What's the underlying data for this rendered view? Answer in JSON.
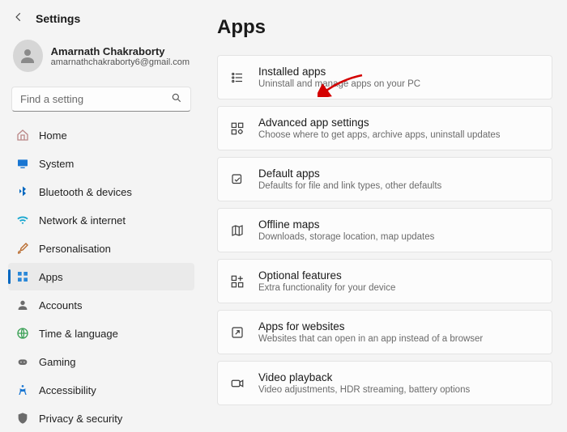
{
  "header": {
    "title": "Settings"
  },
  "user": {
    "name": "Amarnath Chakraborty",
    "email": "amarnathchakraborty6@gmail.com"
  },
  "search": {
    "placeholder": "Find a setting"
  },
  "sidebar": {
    "items": [
      {
        "label": "Home"
      },
      {
        "label": "System"
      },
      {
        "label": "Bluetooth & devices"
      },
      {
        "label": "Network & internet"
      },
      {
        "label": "Personalisation"
      },
      {
        "label": "Apps"
      },
      {
        "label": "Accounts"
      },
      {
        "label": "Time & language"
      },
      {
        "label": "Gaming"
      },
      {
        "label": "Accessibility"
      },
      {
        "label": "Privacy & security"
      }
    ]
  },
  "page": {
    "title": "Apps"
  },
  "cards": [
    {
      "title": "Installed apps",
      "sub": "Uninstall and manage apps on your PC"
    },
    {
      "title": "Advanced app settings",
      "sub": "Choose where to get apps, archive apps, uninstall updates"
    },
    {
      "title": "Default apps",
      "sub": "Defaults for file and link types, other defaults"
    },
    {
      "title": "Offline maps",
      "sub": "Downloads, storage location, map updates"
    },
    {
      "title": "Optional features",
      "sub": "Extra functionality for your device"
    },
    {
      "title": "Apps for websites",
      "sub": "Websites that can open in an app instead of a browser"
    },
    {
      "title": "Video playback",
      "sub": "Video adjustments, HDR streaming, battery options"
    }
  ]
}
